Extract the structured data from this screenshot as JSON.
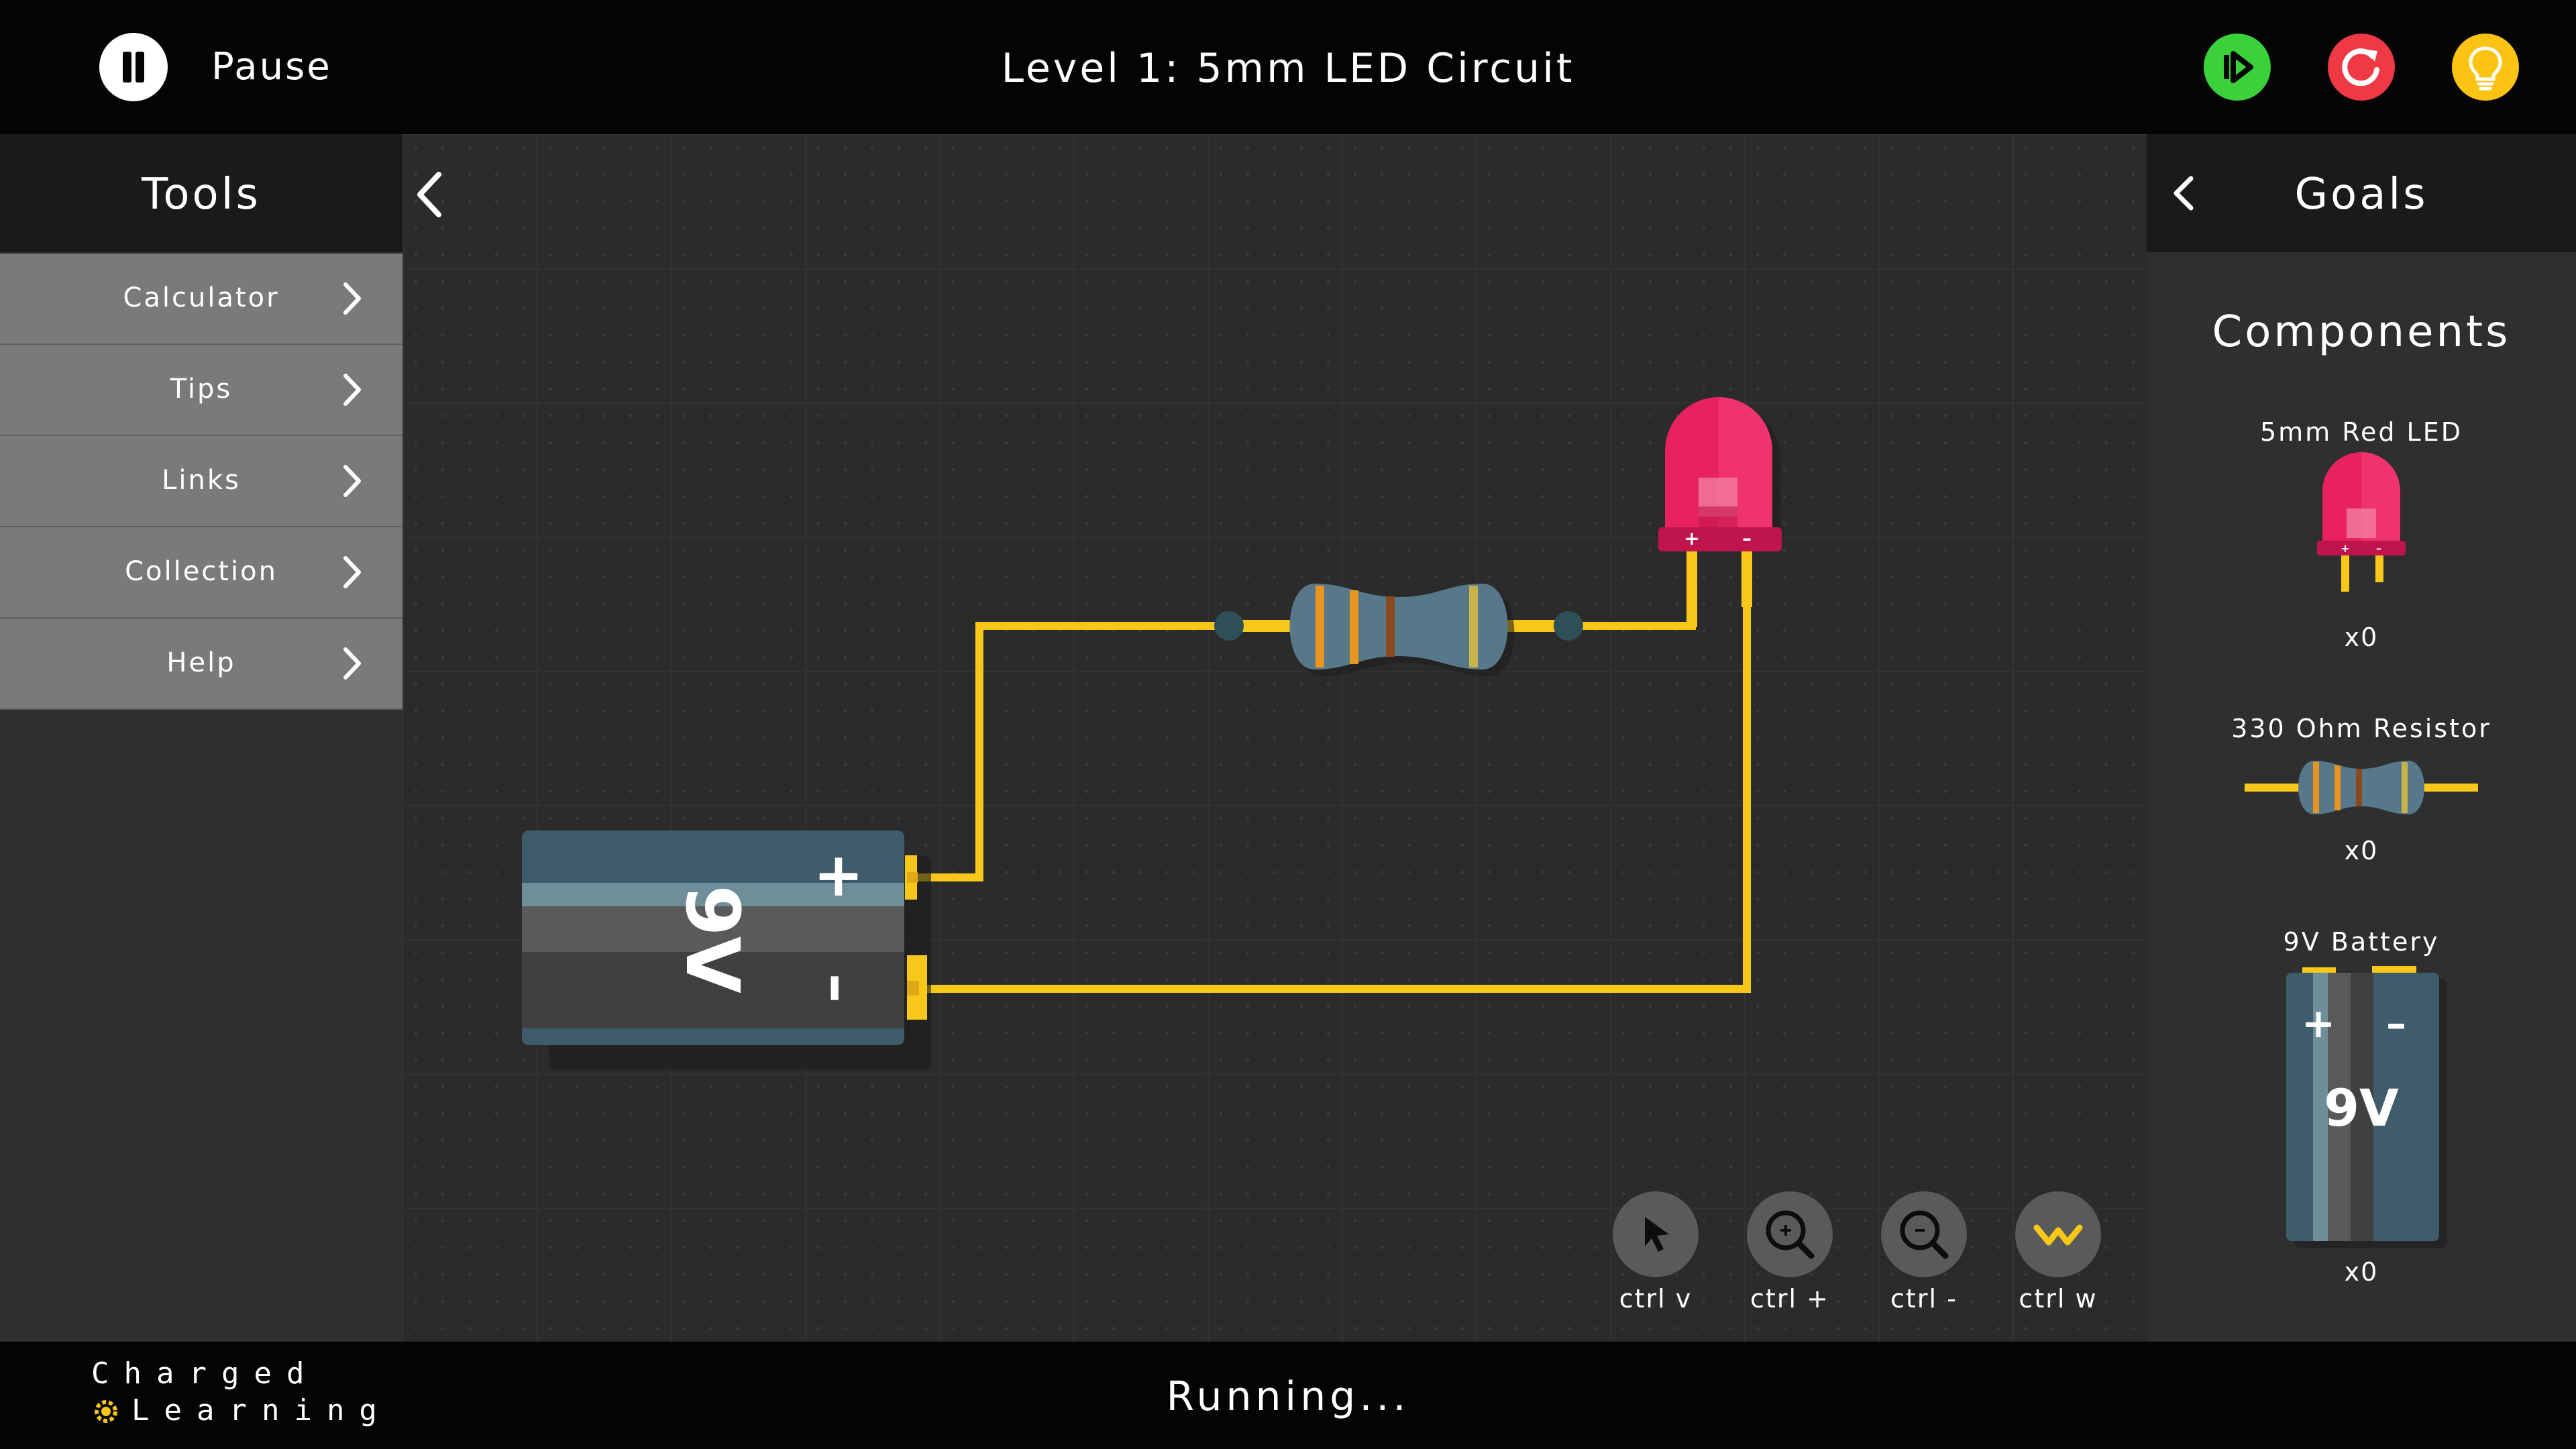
{
  "header": {
    "pause_label": "Pause",
    "level_title": "Level 1: 5mm LED Circuit",
    "play_icon": "play-icon",
    "restart_icon": "restart-icon",
    "hint_icon": "lightbulb-icon"
  },
  "tools": {
    "title": "Tools",
    "items": [
      {
        "label": "Calculator"
      },
      {
        "label": "Tips"
      },
      {
        "label": "Links"
      },
      {
        "label": "Collection"
      },
      {
        "label": "Help"
      }
    ]
  },
  "circuit": {
    "battery_label": "9V",
    "battery_plus": "+",
    "battery_minus": "–",
    "led_plus": "+",
    "led_minus": "–"
  },
  "goals": {
    "title": "Goals",
    "components_title": "Components",
    "items": [
      {
        "name": "5mm Red LED",
        "count": "x0"
      },
      {
        "name": "330 Ohm Resistor",
        "count": "x0"
      },
      {
        "name": "9V Battery",
        "count": "x0",
        "plus": "+",
        "minus": "–",
        "label": "9V"
      }
    ]
  },
  "toolbar": {
    "items": [
      {
        "label": "ctrl v",
        "icon": "cursor-icon"
      },
      {
        "label": "ctrl +",
        "icon": "zoom-in-icon"
      },
      {
        "label": "ctrl -",
        "icon": "zoom-out-icon"
      },
      {
        "label": "ctrl w",
        "icon": "wire-icon"
      }
    ]
  },
  "footer": {
    "status": "Running...",
    "logo_line1": "Charged",
    "logo_line2": "Learning"
  },
  "colors": {
    "wire": "#f7c81a",
    "led": "#e8225f",
    "play": "#3bd13b",
    "restart": "#ef3945",
    "hint": "#fbc313",
    "battery": "#3f5c6a"
  }
}
